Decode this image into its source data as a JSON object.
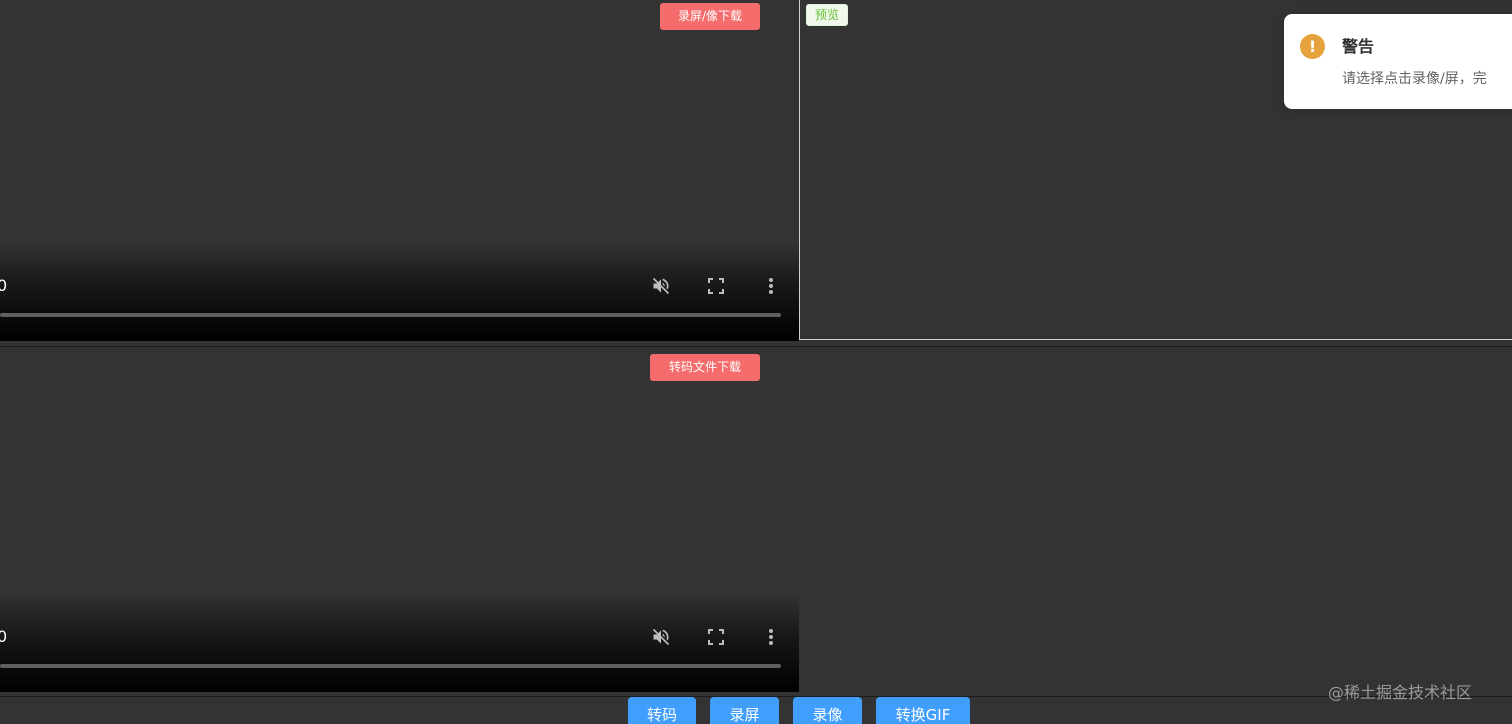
{
  "video_top": {
    "download_label": "录屏/像下载",
    "time_text": "0",
    "icons": [
      "mute-icon",
      "fullscreen-icon",
      "more-vert-icon"
    ]
  },
  "video_bottom": {
    "download_label": "转码文件下载",
    "time_text": "0",
    "icons": [
      "mute-icon",
      "fullscreen-icon",
      "more-vert-icon"
    ]
  },
  "preview": {
    "tag_label": "预览"
  },
  "notification": {
    "icon": "warning-icon",
    "title": "警告",
    "message": "请选择点击录像/屏，完"
  },
  "toolbar": {
    "transcode_label": "转码",
    "record_screen_label": "录屏",
    "record_video_label": "录像",
    "convert_gif_label": "转换GIF"
  },
  "watermark": "@稀土掘金技术社区",
  "colors": {
    "background": "#333333",
    "danger": "#f56c6c",
    "primary": "#409eff",
    "success_tag_text": "#67c23a",
    "warning": "#e6a23c"
  }
}
